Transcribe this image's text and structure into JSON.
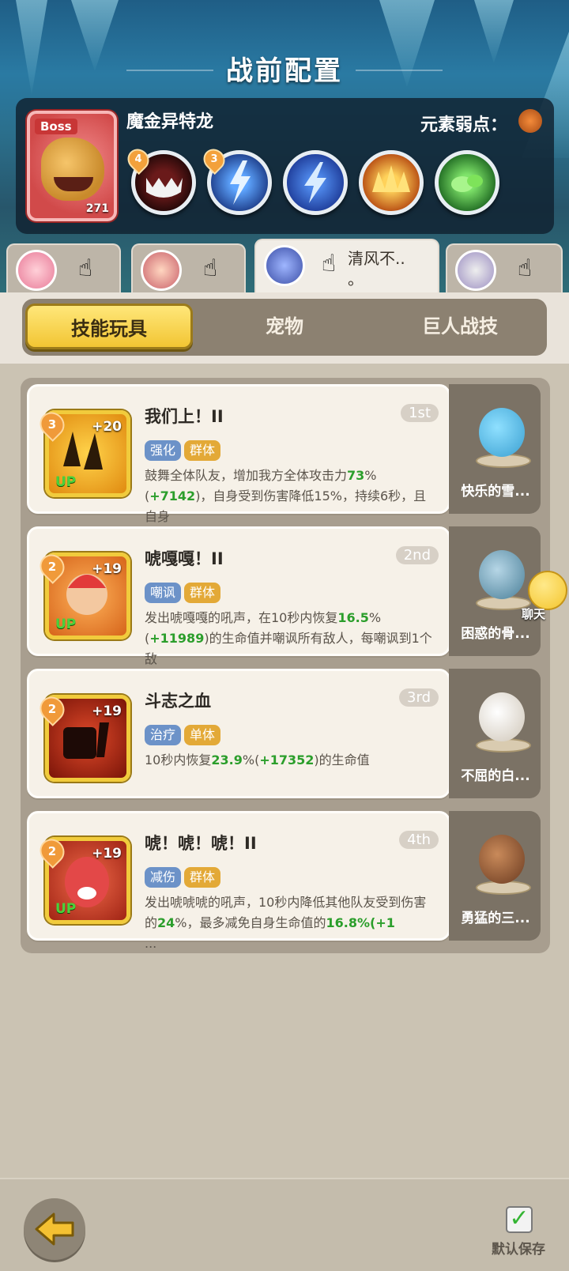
{
  "header": {
    "title": "战前配置"
  },
  "boss": {
    "tag": "Boss",
    "level": "271",
    "name": "魔金异特龙",
    "weakness_label": "元素弱点：",
    "skills": [
      {
        "icon": "fanged-mouth-icon",
        "level": "4"
      },
      {
        "icon": "lightning-storm-icon",
        "level": "3"
      },
      {
        "icon": "lightning-bolt-icon",
        "level": ""
      },
      {
        "icon": "golden-spikes-icon",
        "level": ""
      },
      {
        "icon": "green-slime-icon",
        "level": ""
      }
    ]
  },
  "team": [
    {
      "hero": "hero-1"
    },
    {
      "hero": "hero-2"
    },
    {
      "hero": "hero-3",
      "name": "清风不..",
      "name_line2": "。",
      "active": true
    },
    {
      "hero": "hero-4"
    }
  ],
  "tabs": [
    {
      "label": "技能玩具",
      "active": true
    },
    {
      "label": "宠物",
      "active": false
    },
    {
      "label": "巨人战技",
      "active": false
    }
  ],
  "skills": [
    {
      "level": "3",
      "plus": "+20",
      "up": "UP",
      "title": "我们上！II",
      "rank": "1st",
      "tags": [
        "强化",
        "群体"
      ],
      "desc_a": "鼓舞全体队友，增加我方全体攻击力",
      "desc_b": "73",
      "desc_c": "%(",
      "desc_d": "+7142",
      "desc_e": ")，自身受到伤害降低15%，持续6秒，且自身",
      "desc_more": "...",
      "pet_name": "快乐的雪..."
    },
    {
      "level": "2",
      "plus": "+19",
      "up": "UP",
      "title": "唬嘎嘎！II",
      "rank": "2nd",
      "tags": [
        "嘲讽",
        "群体"
      ],
      "desc_a": "发出唬嘎嘎的吼声，在10秒内恢复",
      "desc_b": "16.5",
      "desc_c": "%(",
      "desc_d": "+11989",
      "desc_e": ")的生命值并嘲讽所有敌人，每嘲讽到1个敌",
      "desc_more": "...",
      "pet_name": "困惑的骨..."
    },
    {
      "level": "2",
      "plus": "+19",
      "up": "",
      "title": "斗志之血",
      "rank": "3rd",
      "tags": [
        "治疗",
        "单体"
      ],
      "desc_a": "10秒内恢复",
      "desc_b": "23.9",
      "desc_c": "%(",
      "desc_d": "+17352",
      "desc_e": ")的生命值",
      "desc_more": "",
      "pet_name": "不屈的白..."
    },
    {
      "level": "2",
      "plus": "+19",
      "up": "UP",
      "title": "唬！唬！唬！II",
      "rank": "4th",
      "tags": [
        "减伤",
        "群体"
      ],
      "desc_a": "发出唬唬唬的吼声，10秒内降低其他队友受到伤害的",
      "desc_b": "24",
      "desc_c": "%，最多减免自身生命值的",
      "desc_d": "16.8%(+1",
      "desc_e": "",
      "desc_more": "...",
      "pet_name": "勇猛的三..."
    }
  ],
  "chat": {
    "label": "聊天"
  },
  "footer": {
    "save_label": "默认保存"
  }
}
